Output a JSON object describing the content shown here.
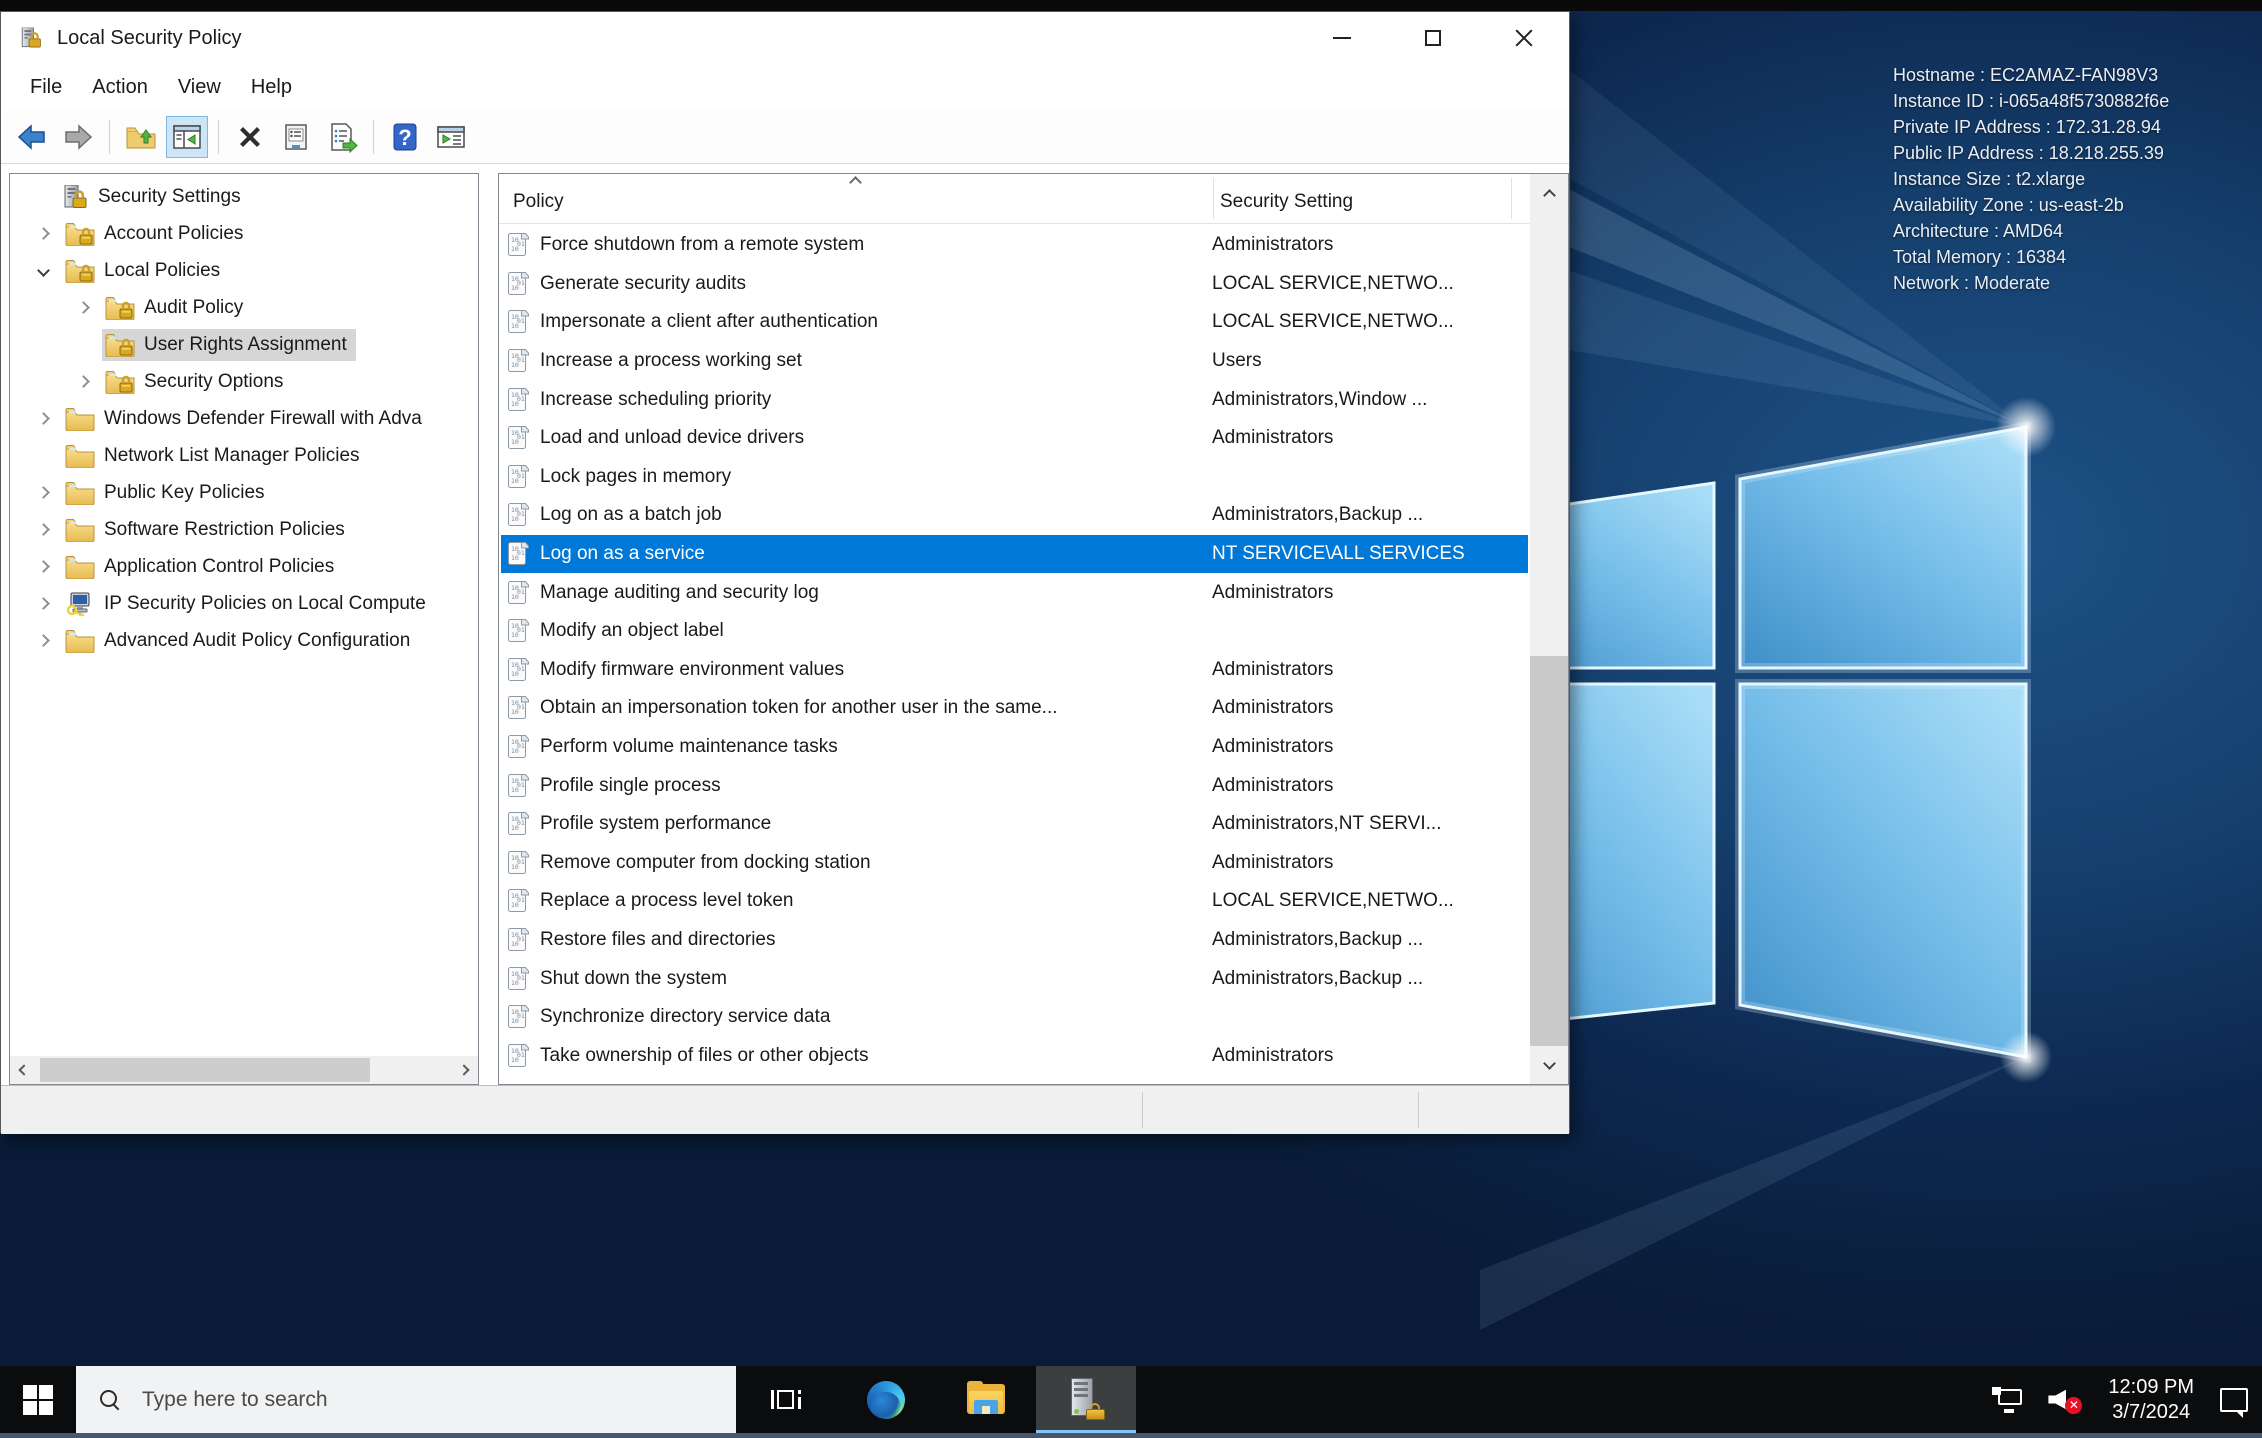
{
  "window": {
    "title": "Local Security Policy"
  },
  "menu": {
    "items": [
      "File",
      "Action",
      "View",
      "Help"
    ]
  },
  "toolbar": {
    "buttons": [
      "back",
      "forward",
      "up-one-level",
      "show-console-tree",
      "delete",
      "properties",
      "export-list",
      "help",
      "new-window"
    ]
  },
  "tree": {
    "items": [
      {
        "label": "Security Settings",
        "level": 0,
        "icon": "computer-lock"
      },
      {
        "label": "Account Policies",
        "level": 1,
        "chevron": "right",
        "icon": "folder-lock"
      },
      {
        "label": "Local Policies",
        "level": 1,
        "chevron": "down",
        "icon": "folder-lock"
      },
      {
        "label": "Audit Policy",
        "level": 2,
        "chevron": "right",
        "icon": "folder-lock"
      },
      {
        "label": "User Rights Assignment",
        "level": 2,
        "icon": "folder-lock",
        "selected": true
      },
      {
        "label": "Security Options",
        "level": 2,
        "chevron": "right",
        "icon": "folder-lock"
      },
      {
        "label": "Windows Defender Firewall with Adva",
        "level": 1,
        "chevron": "right",
        "icon": "folder"
      },
      {
        "label": "Network List Manager Policies",
        "level": 1,
        "icon": "folder"
      },
      {
        "label": "Public Key Policies",
        "level": 1,
        "chevron": "right",
        "icon": "folder"
      },
      {
        "label": "Software Restriction Policies",
        "level": 1,
        "chevron": "right",
        "icon": "folder"
      },
      {
        "label": "Application Control Policies",
        "level": 1,
        "chevron": "right",
        "icon": "folder"
      },
      {
        "label": "IP Security Policies on Local Compute",
        "level": 1,
        "chevron": "right",
        "icon": "computer-key"
      },
      {
        "label": "Advanced Audit Policy Configuration",
        "level": 1,
        "chevron": "right",
        "icon": "folder"
      }
    ]
  },
  "list": {
    "columns": [
      "Policy",
      "Security Setting"
    ],
    "rows": [
      {
        "policy": "Force shutdown from a remote system",
        "setting": "Administrators"
      },
      {
        "policy": "Generate security audits",
        "setting": "LOCAL SERVICE,NETWO..."
      },
      {
        "policy": "Impersonate a client after authentication",
        "setting": "LOCAL SERVICE,NETWO..."
      },
      {
        "policy": "Increase a process working set",
        "setting": "Users"
      },
      {
        "policy": "Increase scheduling priority",
        "setting": "Administrators,Window ..."
      },
      {
        "policy": "Load and unload device drivers",
        "setting": "Administrators"
      },
      {
        "policy": "Lock pages in memory",
        "setting": ""
      },
      {
        "policy": "Log on as a batch job",
        "setting": "Administrators,Backup ..."
      },
      {
        "policy": "Log on as a service",
        "setting": "NT SERVICE\\ALL SERVICES",
        "selected": true
      },
      {
        "policy": "Manage auditing and security log",
        "setting": "Administrators"
      },
      {
        "policy": "Modify an object label",
        "setting": ""
      },
      {
        "policy": "Modify firmware environment values",
        "setting": "Administrators"
      },
      {
        "policy": "Obtain an impersonation token for another user in the same...",
        "setting": "Administrators"
      },
      {
        "policy": "Perform volume maintenance tasks",
        "setting": "Administrators"
      },
      {
        "policy": "Profile single process",
        "setting": "Administrators"
      },
      {
        "policy": "Profile system performance",
        "setting": "Administrators,NT SERVI..."
      },
      {
        "policy": "Remove computer from docking station",
        "setting": "Administrators"
      },
      {
        "policy": "Replace a process level token",
        "setting": "LOCAL SERVICE,NETWO..."
      },
      {
        "policy": "Restore files and directories",
        "setting": "Administrators,Backup ..."
      },
      {
        "policy": "Shut down the system",
        "setting": "Administrators,Backup ..."
      },
      {
        "policy": "Synchronize directory service data",
        "setting": ""
      },
      {
        "policy": "Take ownership of files or other objects",
        "setting": "Administrators"
      }
    ]
  },
  "desktop": {
    "info_lines": [
      "Hostname : EC2AMAZ-FAN98V3",
      "Instance ID : i-065a48f5730882f6e",
      "Private IP Address : 172.31.28.94",
      "Public IP Address : 18.218.255.39",
      "Instance Size : t2.xlarge",
      "Availability Zone : us-east-2b",
      "Architecture : AMD64",
      "Total Memory : 16384",
      "Network : Moderate"
    ]
  },
  "taskbar": {
    "search_placeholder": "Type here to search",
    "time": "12:09 PM",
    "date": "3/7/2024",
    "volume_muted_mark": "✕"
  },
  "colors": {
    "selection_blue": "#0078d7",
    "tree_selection_gray": "#d6d6d6",
    "taskbar_black": "#0b0c0d",
    "desktop_navy": "#143a66"
  }
}
